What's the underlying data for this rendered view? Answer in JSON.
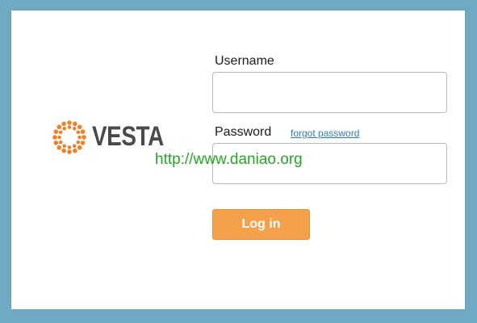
{
  "logo": {
    "text": "VESTA",
    "icon": "vesta-dotted-circle-logo",
    "icon_color": "#f0812a"
  },
  "form": {
    "username_label": "Username",
    "username_value": "",
    "password_label": "Password",
    "password_value": "",
    "forgot_link": "forgot password",
    "login_button": "Log in"
  },
  "watermark": "http://www.daniao.org",
  "colors": {
    "background": "#6fa9c4",
    "button": "#f5a04a",
    "link": "#2c7fb8",
    "watermark": "#22aa22"
  }
}
